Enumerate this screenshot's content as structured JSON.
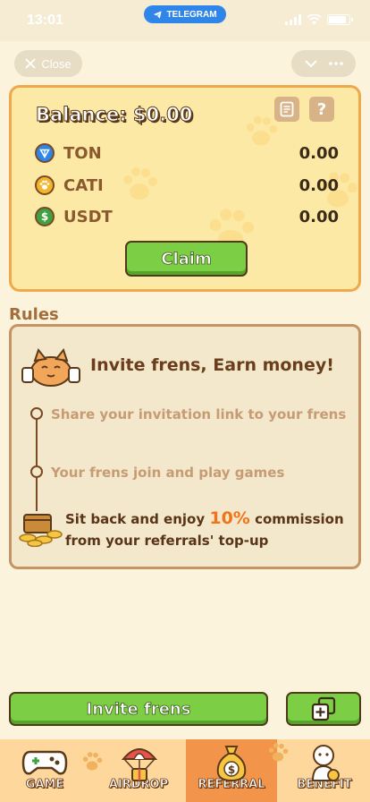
{
  "status_bar": {
    "time": "13:01",
    "source_app": "TELEGRAM"
  },
  "top_controls": {
    "close_label": "Close"
  },
  "balance_card": {
    "title": "Balance: $0.00",
    "coins": [
      {
        "name": "TON",
        "amount": "0.00",
        "color": "#2f86e8"
      },
      {
        "name": "CATI",
        "amount": "0.00",
        "color": "#f2b52a"
      },
      {
        "name": "USDT",
        "amount": "0.00",
        "color": "#3fa140"
      }
    ],
    "claim_label": "Claim",
    "help_glyph": "?"
  },
  "rules": {
    "heading": "Rules",
    "title": "Invite frens, Earn money!",
    "steps": [
      "Share your invitation link to your frens",
      "Your frens join and play games"
    ],
    "final_prefix": "Sit back and enjoy",
    "final_percent": "10%",
    "final_suffix": "commission",
    "final_line2": "from your referrals' top-up"
  },
  "actions": {
    "invite_label": "Invite frens"
  },
  "tabbar": {
    "active": "REFERRAL",
    "tabs": [
      {
        "label": "GAME",
        "icon": "gamepad-icon"
      },
      {
        "label": "AIRDROP",
        "icon": "parachute-gift-icon"
      },
      {
        "label": "REFERRAL",
        "icon": "money-bag-icon"
      },
      {
        "label": "BENEFIT",
        "icon": "mascot-icon"
      }
    ]
  },
  "colors": {
    "accent_green": "#7ccf45",
    "card_fill": "#fde9a6",
    "card_border": "#efa84a",
    "active_tab": "#f2954a",
    "highlight": "#f0751a"
  }
}
